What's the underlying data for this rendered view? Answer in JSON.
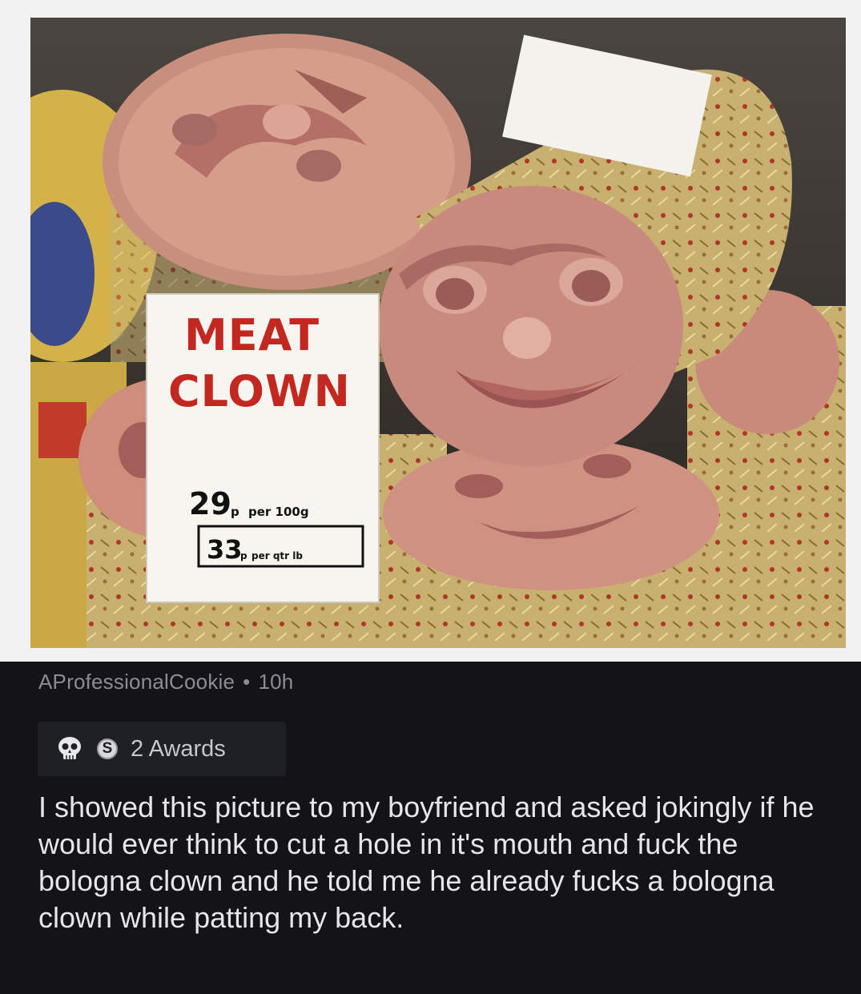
{
  "photo": {
    "sign": {
      "title_line1": "MEAT",
      "title_line2": "CLOWN",
      "price1_value": "29",
      "price1_currency": "p",
      "price1_unit": "per 100g",
      "price2_value": "33",
      "price2_currency": "p",
      "price2_unit": "per qtr lb"
    }
  },
  "post": {
    "author": "AProfessionalCookie",
    "separator": "•",
    "age": "10h",
    "awards": {
      "icons": [
        "skull-award-icon",
        "silver-coin-award-icon"
      ],
      "coin_glyph": "S",
      "label": "2 Awards"
    },
    "body": "I showed this picture to my boyfriend and asked jokingly if he would ever think to cut a hole in it's mouth and fuck the bologna clown and he told me he already fucks a bologna clown while patting my back."
  },
  "colors": {
    "background": "#131318",
    "meta_text": "#8c8c94",
    "body_text": "#e6e6ea",
    "sign_red": "#c2281f"
  }
}
